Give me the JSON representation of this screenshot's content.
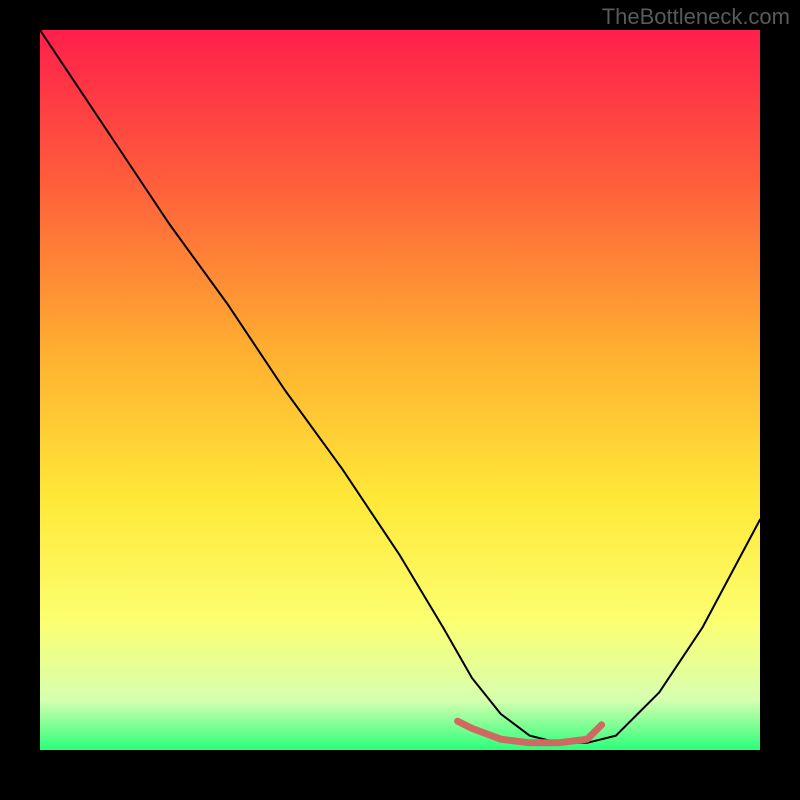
{
  "watermark": "TheBottleneck.com",
  "chart_data": {
    "type": "line",
    "title": "",
    "xlabel": "",
    "ylabel": "",
    "xlim": [
      0,
      100
    ],
    "ylim": [
      0,
      100
    ],
    "gradient_stops": [
      {
        "offset": 0,
        "color": "#ff1f4b"
      },
      {
        "offset": 20,
        "color": "#ff5a3c"
      },
      {
        "offset": 45,
        "color": "#ffb030"
      },
      {
        "offset": 65,
        "color": "#ffe838"
      },
      {
        "offset": 82,
        "color": "#fcff70"
      },
      {
        "offset": 93,
        "color": "#d7ffb0"
      },
      {
        "offset": 100,
        "color": "#2bff7a"
      }
    ],
    "series": [
      {
        "name": "curve",
        "color": "#000000",
        "width": 2,
        "x": [
          0,
          4,
          10,
          18,
          26,
          34,
          42,
          50,
          56,
          60,
          64,
          68,
          72,
          76,
          80,
          86,
          92,
          100
        ],
        "y": [
          100,
          94,
          85,
          73,
          62,
          50,
          39,
          27,
          17,
          10,
          5,
          2,
          1,
          1,
          2,
          8,
          17,
          32
        ]
      },
      {
        "name": "highlight",
        "color": "#cf6a63",
        "width": 7,
        "x": [
          58,
          60,
          64,
          68,
          72,
          76,
          78
        ],
        "y": [
          4,
          3,
          1.5,
          1,
          1,
          1.5,
          3.5
        ]
      }
    ]
  }
}
